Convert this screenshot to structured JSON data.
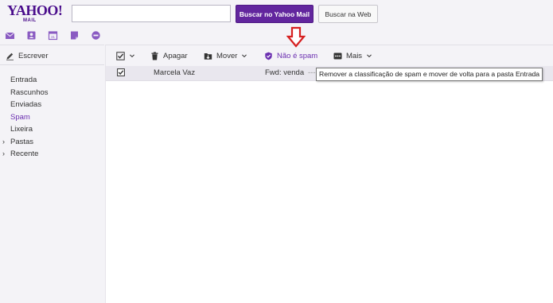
{
  "header": {
    "logo_main": "YAHOO!",
    "logo_sub": "MAIL",
    "search_value": "",
    "search_mail_label": "Buscar no Yahoo Mail",
    "search_web_label": "Buscar na Web",
    "app_icons": [
      "mail-icon",
      "contacts-icon",
      "calendar-icon",
      "notepad-icon",
      "messenger-icon"
    ]
  },
  "sidebar": {
    "compose_label": "Escrever",
    "folders": [
      {
        "label": "Entrada",
        "active": false,
        "expandable": false
      },
      {
        "label": "Rascunhos",
        "active": false,
        "expandable": false
      },
      {
        "label": "Enviadas",
        "active": false,
        "expandable": false
      },
      {
        "label": "Spam",
        "active": true,
        "expandable": false
      },
      {
        "label": "Lixeira",
        "active": false,
        "expandable": false
      },
      {
        "label": "Pastas",
        "active": false,
        "expandable": true
      },
      {
        "label": "Recente",
        "active": false,
        "expandable": true
      }
    ]
  },
  "toolbar": {
    "delete_label": "Apagar",
    "move_label": "Mover",
    "not_spam_label": "Não é spam",
    "more_label": "Mais"
  },
  "messages": [
    {
      "sender": "Marcela Vaz",
      "subject": "Fwd: venda",
      "snippet": "---",
      "checked": true
    }
  ],
  "tooltip": {
    "text": "Remover a classificação de spam e mover de volta para a pasta Entrada"
  },
  "colors": {
    "brand": "#4a0d8c",
    "accent": "#62269e",
    "active_folder": "#6b2fb0",
    "annotation_arrow": "#d62020"
  }
}
